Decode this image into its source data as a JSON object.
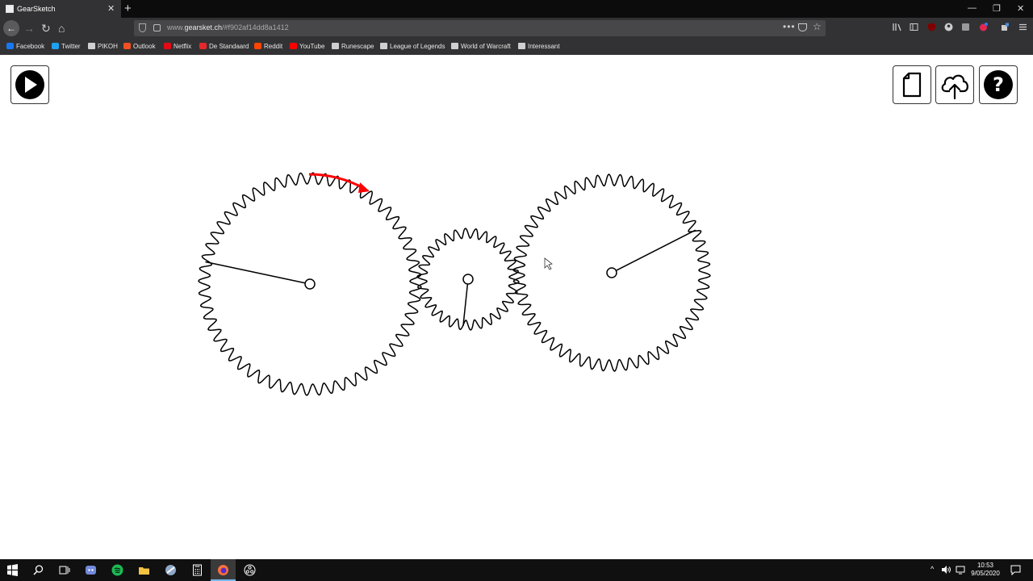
{
  "browser": {
    "tab_title": "GearSketch",
    "tab_close": "✕",
    "new_tab": "+",
    "url_prefix": "www.",
    "url_host": "gearsket.ch",
    "url_path": "/#f902af14dd8a1412",
    "bookmarks": [
      {
        "label": "Facebook",
        "icon": "facebook-icon",
        "color": "#1877f2"
      },
      {
        "label": "Twitter",
        "icon": "twitter-icon",
        "color": "#1da1f2"
      },
      {
        "label": "PIKOH",
        "icon": "folder-icon",
        "color": "#cfcfcf"
      },
      {
        "label": "Outlook",
        "icon": "windows-icon",
        "color": "#f25022"
      },
      {
        "label": "Netflix",
        "icon": "netflix-icon",
        "color": "#e50914"
      },
      {
        "label": "De Standaard",
        "icon": "ds-icon",
        "color": "#e8262c"
      },
      {
        "label": "Reddit",
        "icon": "reddit-icon",
        "color": "#ff4500"
      },
      {
        "label": "YouTube",
        "icon": "youtube-icon",
        "color": "#ff0000"
      },
      {
        "label": "Runescape",
        "icon": "folder-icon",
        "color": "#cfcfcf"
      },
      {
        "label": "League of Legends",
        "icon": "folder-icon",
        "color": "#cfcfcf"
      },
      {
        "label": "World of Warcraft",
        "icon": "folder-icon",
        "color": "#cfcfcf"
      },
      {
        "label": "Interessant",
        "icon": "folder-icon",
        "color": "#cfcfcf"
      }
    ]
  },
  "app": {
    "buttons": [
      {
        "name": "play-button",
        "icon": "play-icon"
      },
      {
        "name": "new-document-button",
        "icon": "document-icon"
      },
      {
        "name": "cloud-upload-button",
        "icon": "cloud-upload-icon"
      },
      {
        "name": "help-button",
        "icon": "help-icon"
      }
    ],
    "gears": [
      {
        "name": "large-gear-left",
        "teeth": 56,
        "arm_angle_deg": 192
      },
      {
        "name": "small-gear-middle",
        "teeth": 30,
        "arm_angle_deg": 96
      },
      {
        "name": "large-gear-right",
        "teeth": 54,
        "arm_angle_deg": -27
      }
    ],
    "rotation_arrow_color": "#ff0000",
    "gear_stroke_color": "#000000"
  },
  "taskbar": {
    "time": "10:53",
    "date": "9/05/2020"
  }
}
